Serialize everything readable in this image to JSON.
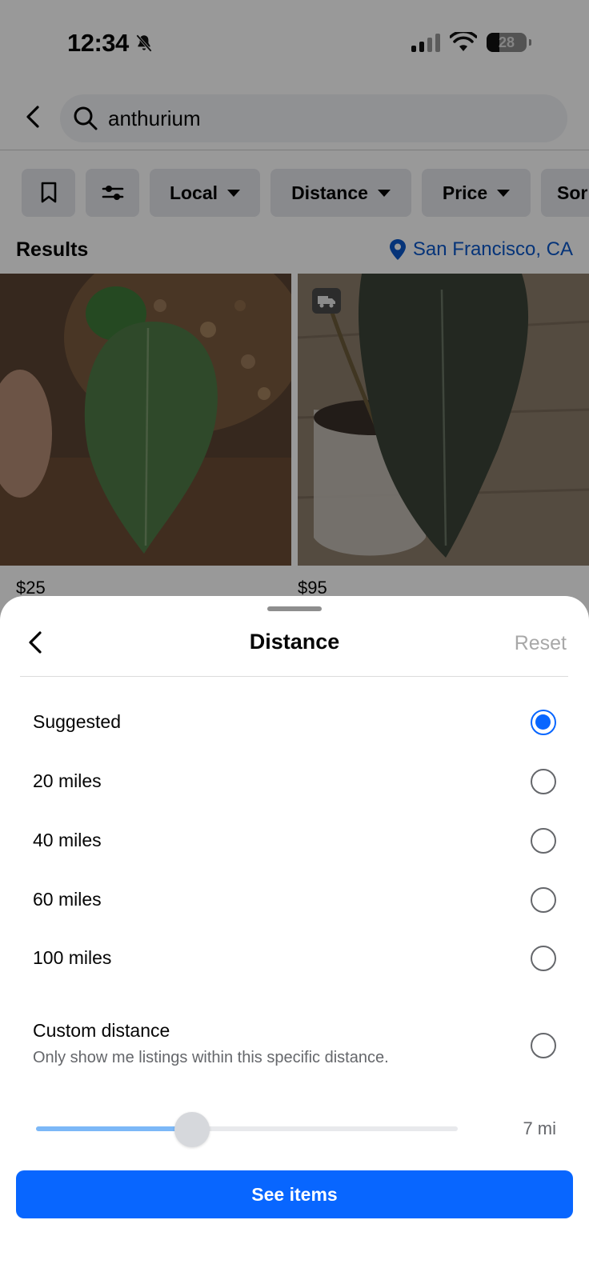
{
  "status_bar": {
    "time": "12:34",
    "battery": "28",
    "icons": [
      "bell-slash-icon",
      "cellular-signal-icon",
      "wifi-icon",
      "battery-icon"
    ]
  },
  "search": {
    "query": "anthurium",
    "back_icon": "chevron-left-icon",
    "search_icon": "search-icon"
  },
  "filters": {
    "chips": [
      {
        "icon": "bookmark-icon"
      },
      {
        "icon": "sliders-icon"
      },
      {
        "label": "Local"
      },
      {
        "label": "Distance"
      },
      {
        "label": "Price"
      },
      {
        "label": "Sor"
      }
    ]
  },
  "results": {
    "title": "Results",
    "location": "San Francisco, CA",
    "listings": [
      {
        "price": "$25"
      },
      {
        "price": "$95",
        "badge_icon": "delivery-truck-icon"
      }
    ]
  },
  "sheet": {
    "title": "Distance",
    "reset_label": "Reset",
    "options": [
      {
        "label": "Suggested",
        "selected": true
      },
      {
        "label": "20 miles",
        "selected": false
      },
      {
        "label": "40 miles",
        "selected": false
      },
      {
        "label": "60 miles",
        "selected": false
      },
      {
        "label": "100 miles",
        "selected": false
      }
    ],
    "custom": {
      "title": "Custom distance",
      "subtitle": "Only show me listings within this specific distance.",
      "selected": false
    },
    "slider": {
      "value_label": "7 mi",
      "fraction": 0.37
    },
    "primary_button": "See items"
  },
  "colors": {
    "accent": "#0866ff",
    "link": "#0a58ca",
    "muted": "#65676b"
  }
}
